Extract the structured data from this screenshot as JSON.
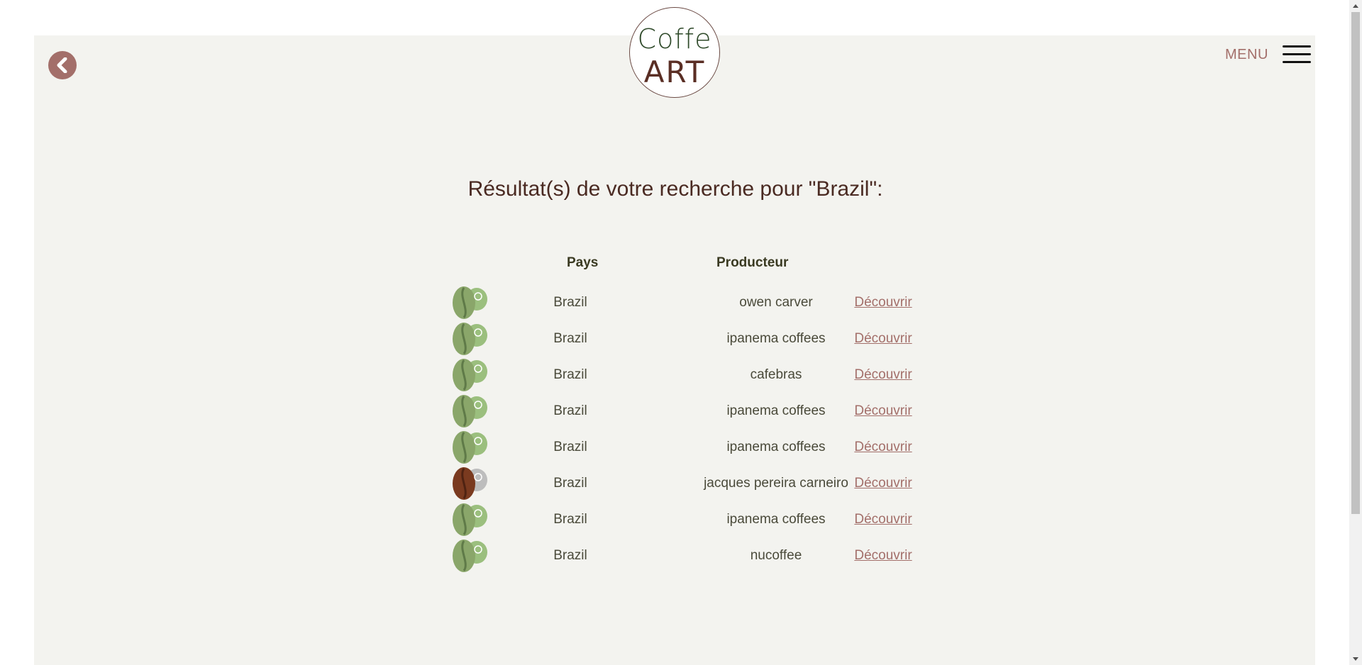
{
  "header": {
    "logo": {
      "top_word": "Coffe",
      "bottom_word": "ART"
    },
    "menu_label": "MENU"
  },
  "search": {
    "title": "Résultat(s) de votre recherche pour \"Brazil\":"
  },
  "table": {
    "headers": {
      "country": "Pays",
      "producer": "Producteur"
    },
    "rows": [
      {
        "country": "Brazil",
        "producer": "owen carver",
        "link": "Découvrir",
        "bean": "green"
      },
      {
        "country": "Brazil",
        "producer": "ipanema coffees",
        "link": "Découvrir",
        "bean": "green"
      },
      {
        "country": "Brazil",
        "producer": "cafebras",
        "link": "Découvrir",
        "bean": "green"
      },
      {
        "country": "Brazil",
        "producer": "ipanema coffees",
        "link": "Découvrir",
        "bean": "green"
      },
      {
        "country": "Brazil",
        "producer": "ipanema coffees",
        "link": "Découvrir",
        "bean": "green"
      },
      {
        "country": "Brazil",
        "producer": "jacques pereira carneiro",
        "link": "Découvrir",
        "bean": "roasted"
      },
      {
        "country": "Brazil",
        "producer": "ipanema coffees",
        "link": "Découvrir",
        "bean": "green"
      },
      {
        "country": "Brazil",
        "producer": "nucoffee",
        "link": "Découvrir",
        "bean": "green"
      }
    ]
  },
  "colors": {
    "accent": "#a36f6a",
    "background": "#f3f3ef",
    "title": "#4a2a22",
    "green_bean": "#8aa66a",
    "roasted_bean": "#7a3a1f"
  }
}
